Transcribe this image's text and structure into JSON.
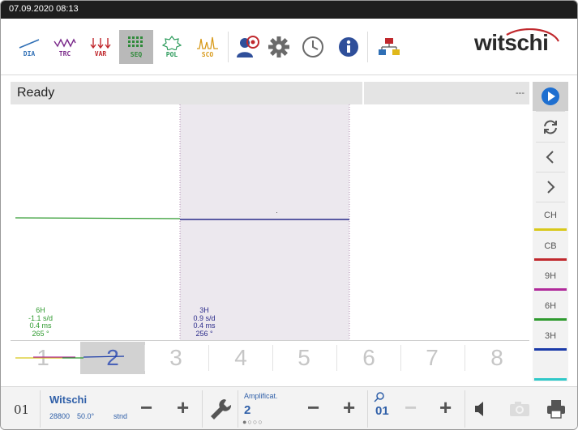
{
  "status": {
    "datetime": "07.09.2020  08:13"
  },
  "toolbar": {
    "buttons": [
      {
        "id": "dia",
        "label": "DIA",
        "color": "#2f6fb5"
      },
      {
        "id": "trc",
        "label": "TRC",
        "color": "#7a2a8a"
      },
      {
        "id": "var",
        "label": "VAR",
        "color": "#c0282d"
      },
      {
        "id": "seq",
        "label": "SEQ",
        "color": "#2f8a3a",
        "active": true
      },
      {
        "id": "pol",
        "label": "POL",
        "color": "#2a9a5a"
      },
      {
        "id": "sco",
        "label": "SCO",
        "color": "#d89a1a"
      }
    ],
    "logo": "witschi"
  },
  "readybar": {
    "status": "Ready",
    "right_value": "---"
  },
  "traces": [
    {
      "name": "6H",
      "rate": "-1.1 s/d",
      "beat_error": "0.4 ms",
      "amplitude": "265 °",
      "color": "#2f9a2f"
    },
    {
      "name": "3H",
      "rate": "0.9 s/d",
      "beat_error": "0.4 ms",
      "amplitude": "256 °",
      "color": "#2a2a8a"
    }
  ],
  "sequence": {
    "positions": [
      "1",
      "2",
      "3",
      "4",
      "5",
      "6",
      "7",
      "8"
    ],
    "active_index": 1
  },
  "sidebar": {
    "channels": [
      {
        "label": "CH",
        "color": "#d8c81a"
      },
      {
        "label": "CB",
        "color": "#c0282d"
      },
      {
        "label": "9H",
        "color": "#b02a9a"
      },
      {
        "label": "6H",
        "color": "#2f9a2f"
      },
      {
        "label": "3H",
        "color": "#1a3aa8"
      },
      {
        "label": "",
        "color": "#2fc8c8"
      }
    ]
  },
  "bottombar": {
    "program_number": "01",
    "profile_name": "Witschi",
    "frequency": "28800",
    "lift_angle": "50.0°",
    "mode": "stnd",
    "amplification_label": "Amplificat.",
    "amplification_value": "2",
    "page_dots": "●○○○",
    "zoom_value": "01"
  },
  "colors": {
    "accent": "#2f5fa8",
    "play": "#1e6fd0"
  }
}
